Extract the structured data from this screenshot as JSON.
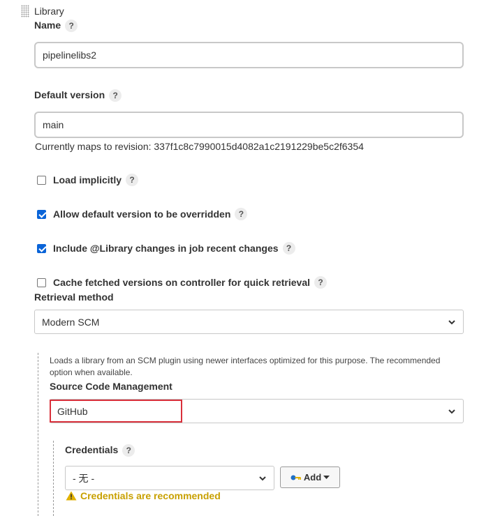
{
  "library": {
    "section_title": "Library",
    "name": {
      "label": "Name",
      "value": "pipelinelibs2",
      "help": "?"
    },
    "default_version": {
      "label": "Default version",
      "value": "main",
      "help": "?",
      "revision_note": "Currently maps to revision: 337f1c8c7990015d4082a1c2191229be5c2f6354"
    },
    "options": [
      {
        "label": "Load implicitly",
        "checked": false,
        "help": "?"
      },
      {
        "label": "Allow default version to be overridden",
        "checked": true,
        "help": "?"
      },
      {
        "label": "Include @Library changes in job recent changes",
        "checked": true,
        "help": "?"
      },
      {
        "label": "Cache fetched versions on controller for quick retrieval",
        "checked": false,
        "help": "?"
      }
    ],
    "retrieval_method": {
      "label": "Retrieval method",
      "selected": "Modern SCM"
    },
    "scm": {
      "description": "Loads a library from an SCM plugin using newer interfaces optimized for this purpose. The recommended option when available.",
      "label": "Source Code Management",
      "selected": "GitHub"
    },
    "credentials": {
      "label": "Credentials",
      "help": "?",
      "selected": "- 无 -",
      "add_label": "Add",
      "warning": "Credentials are recommended"
    }
  },
  "colors": {
    "checkbox_checked": "#0a64d8",
    "highlight_border": "#d9303b",
    "warning_text": "#c8a000"
  }
}
